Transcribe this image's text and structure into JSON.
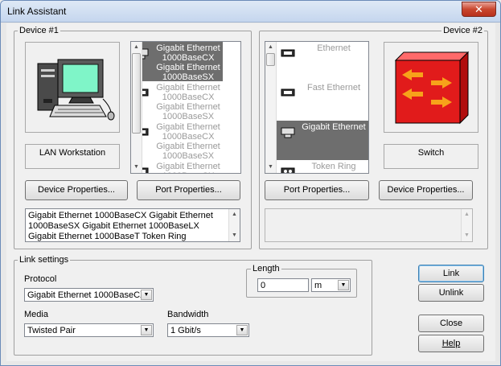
{
  "window": {
    "title": "Link Assistant",
    "close_glyph": "✕"
  },
  "device1": {
    "label": "Device #1",
    "device_name": "LAN Workstation",
    "icon": "workstation-icon",
    "port_list": [
      {
        "text": "Gigabit Ethernet 1000BaseCX Gigabit Ethernet 1000BaseSX",
        "selected": true
      },
      {
        "text": "Gigabit Ethernet 1000BaseCX Gigabit Ethernet 1000BaseSX",
        "selected": false
      },
      {
        "text": "Gigabit Ethernet 1000BaseCX Gigabit Ethernet 1000BaseSX",
        "selected": false
      },
      {
        "text": "Gigabit Ethernet 1000BaseCX Gigabit Ethernet 1000BaseCX",
        "selected": false
      }
    ],
    "device_properties_label": "Device Properties...",
    "port_properties_label": "Port Properties...",
    "summary": "Gigabit Ethernet 1000BaseCX Gigabit Ethernet 1000BaseSX Gigabit Ethernet 1000BaseLX Gigabit Ethernet 1000BaseT Token Ring"
  },
  "device2": {
    "label": "Device #2",
    "device_name": "Switch",
    "icon": "switch-icon",
    "port_list": [
      {
        "text": "Ethernet",
        "selected": false
      },
      {
        "text": "Fast Ethernet",
        "selected": false
      },
      {
        "text": "Gigabit Ethernet",
        "selected": true
      },
      {
        "text": "Token Ring",
        "selected": false
      }
    ],
    "port_properties_label": "Port Properties...",
    "device_properties_label": "Device Properties...",
    "summary": ""
  },
  "link_settings": {
    "label": "Link settings",
    "protocol_label": "Protocol",
    "protocol_value": "Gigabit Ethernet 1000BaseCX",
    "media_label": "Media",
    "media_value": "Twisted Pair",
    "bandwidth_label": "Bandwidth",
    "bandwidth_value": "1 Gbit/s",
    "length_label": "Length",
    "length_value": "0",
    "length_unit": "m"
  },
  "buttons": {
    "link": "Link",
    "unlink": "Unlink",
    "close": "Close",
    "help": "Help"
  },
  "colors": {
    "selection": "#6e6e6e",
    "switch_red": "#e11b1b",
    "arrow_orange": "#f7a21a",
    "monitor_green": "#7ff5c8"
  }
}
